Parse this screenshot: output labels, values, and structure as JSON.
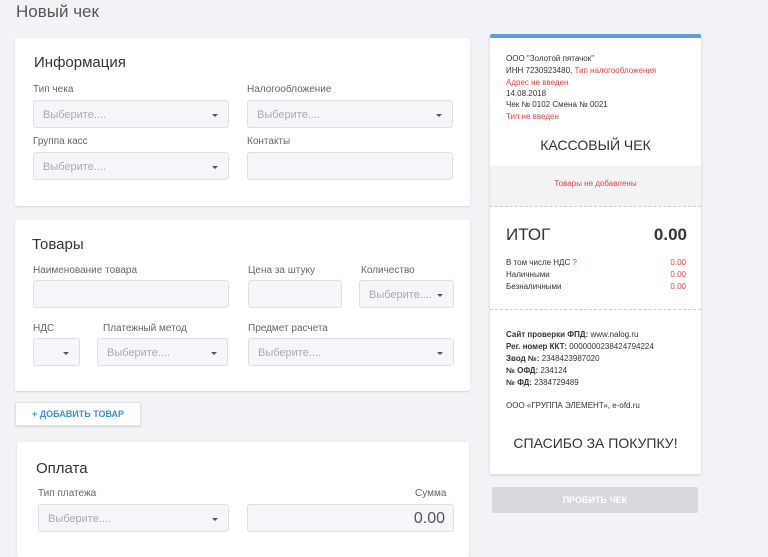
{
  "page": {
    "title": "Новый чек"
  },
  "info": {
    "title": "Информация",
    "receipt_type_label": "Тип чека",
    "receipt_type_placeholder": "Выберите....",
    "taxation_label": "Налогообложение",
    "taxation_placeholder": "Выберите....",
    "register_group_label": "Группа касс",
    "register_group_placeholder": "Выберите....",
    "contacts_label": "Контакты"
  },
  "goods": {
    "title": "Товары",
    "name_label": "Наименование товара",
    "price_label": "Цена за штуку",
    "quantity_label": "Количество",
    "quantity_placeholder": "Выберите....",
    "vat_label": "НДС",
    "payment_method_label": "Платежный метод",
    "payment_method_placeholder": "Выберите....",
    "subject_label": "Предмет расчета",
    "subject_placeholder": "Выберите...."
  },
  "add_item_button": "+ ДОБАВИТЬ ТОВАР",
  "payment": {
    "title": "Оплата",
    "type_label": "Тип платежа",
    "type_placeholder": "Выберите....",
    "sum_label": "Сумма",
    "sum_value": "0.00"
  },
  "receipt": {
    "company": "ООО \"Золотой пятачок\"",
    "inn": "ИНН 7230923480,",
    "tax_missing": "Тип налогообложения",
    "address_missing": "Адрес не введен",
    "date": "14.08.2018",
    "check_shift": "Чек № 0102 Смена № 0021",
    "type_missing": "Тип не введен",
    "heading": "КАССОВЫЙ ЧЕК",
    "no_goods": "Товары не добавлены",
    "total_label": "ИТОГ",
    "total_value": "0.00",
    "rows": [
      {
        "label": "В том числе НДС",
        "mark": "?",
        "value": "0.00"
      },
      {
        "label": "Наличными",
        "value": "0.00"
      },
      {
        "label": "Безналичными",
        "value": "0.00"
      }
    ],
    "fns_site": "Сайт проверки ФПД:",
    "fns_site_value": "www.nalog.ru",
    "kkt_reg": "Рег. номер ККТ:",
    "kkt_reg_value": "0000000238424794224",
    "factory_no": "Звод №:",
    "factory_no_value": "2348423987020",
    "ofd_no": "№ ОФД:",
    "ofd_no_value": "234124",
    "fd_no": "№ ФД:",
    "fd_no_value": "2384729489",
    "provider": "ООО «ГРУППА ЭЛЕМЕНТ», e-ofd.ru",
    "thanks": "СПАСИБО ЗА ПОКУПКУ!"
  },
  "pay_button": "ПРОБИТЬ ЧЕК",
  "colors": {
    "accent": "#3d8fd9",
    "error": "#e04545",
    "receipt_top": "#5b9fe0"
  }
}
